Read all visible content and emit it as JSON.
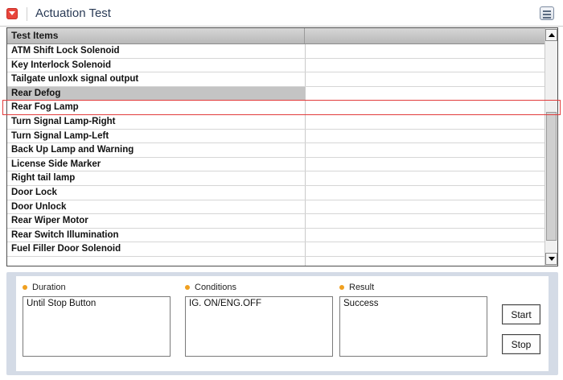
{
  "header": {
    "title": "Actuation Test",
    "icons": {
      "title": "red-collapse-icon",
      "menu": "list-menu-icon"
    }
  },
  "table": {
    "columns": [
      "Test Items",
      ""
    ],
    "rows": [
      "ATM Shift Lock Solenoid",
      "Key Interlock Solenoid",
      "Tailgate unloxk signal output",
      "Rear Defog",
      "Rear Fog Lamp",
      "Turn Signal Lamp-Right",
      "Turn Signal Lamp-Left",
      "Back Up Lamp and Warning",
      "License Side Marker",
      "Right tail lamp",
      "Door Lock",
      "Door Unlock",
      "Rear Wiper Motor",
      "Rear Switch Illumination",
      "Fuel Filler Door Solenoid",
      ""
    ],
    "selected_item": "Rear Defog",
    "highlighted_item": "Rear Fog Lamp"
  },
  "scrollbar": {
    "position_fraction": 0.85
  },
  "panel": {
    "duration": {
      "label": "Duration",
      "value": "Until Stop Button"
    },
    "conditions": {
      "label": "Conditions",
      "value": "IG. ON/ENG.OFF"
    },
    "result": {
      "label": "Result",
      "value": "Success"
    },
    "start_label": "Start",
    "stop_label": "Stop"
  },
  "colors": {
    "accent_red": "#e8453c",
    "title_text": "#2a3b56",
    "bullet": "#f0a020",
    "panel_bg": "#d4dbe6",
    "selected_row": "#c4c4c4",
    "highlight_border": "#e23b3b"
  }
}
